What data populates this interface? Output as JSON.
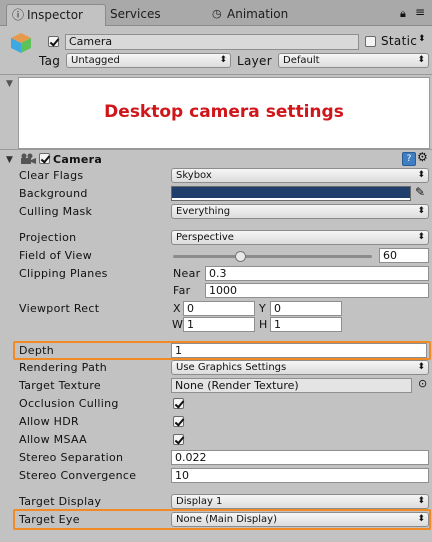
{
  "tabs": {
    "inspector": "Inspector",
    "services": "Services",
    "animation": "Animation"
  },
  "object": {
    "name": "Camera",
    "static_label": "Static",
    "tag_label": "Tag",
    "tag_value": "Untagged",
    "layer_label": "Layer",
    "layer_value": "Default"
  },
  "note": {
    "text": "Desktop camera settings"
  },
  "component": {
    "title": "Camera"
  },
  "props": {
    "clear_flags": {
      "label": "Clear Flags",
      "value": "Skybox"
    },
    "background": {
      "label": "Background",
      "color": "#1f3e6b"
    },
    "culling_mask": {
      "label": "Culling Mask",
      "value": "Everything"
    },
    "projection": {
      "label": "Projection",
      "value": "Perspective"
    },
    "fov": {
      "label": "Field of View",
      "value": "60",
      "slider_fraction": 0.34
    },
    "clipping": {
      "label": "Clipping Planes",
      "near_label": "Near",
      "near": "0.3",
      "far_label": "Far",
      "far": "1000"
    },
    "viewport": {
      "label": "Viewport Rect",
      "x_label": "X",
      "x": "0",
      "y_label": "Y",
      "y": "0",
      "w_label": "W",
      "w": "1",
      "h_label": "H",
      "h": "1"
    },
    "depth": {
      "label": "Depth",
      "value": "1"
    },
    "rendering_path": {
      "label": "Rendering Path",
      "value": "Use Graphics Settings"
    },
    "target_texture": {
      "label": "Target Texture",
      "value": "None (Render Texture)"
    },
    "occlusion": {
      "label": "Occlusion Culling"
    },
    "hdr": {
      "label": "Allow HDR"
    },
    "msaa": {
      "label": "Allow MSAA"
    },
    "stereo_sep": {
      "label": "Stereo Separation",
      "value": "0.022"
    },
    "stereo_conv": {
      "label": "Stereo Convergence",
      "value": "10"
    },
    "target_display": {
      "label": "Target Display",
      "value": "Display 1"
    },
    "target_eye": {
      "label": "Target Eye",
      "value": "None (Main Display)"
    }
  },
  "colors": {
    "highlight": "#f08a24",
    "note_text": "#d0161a"
  }
}
